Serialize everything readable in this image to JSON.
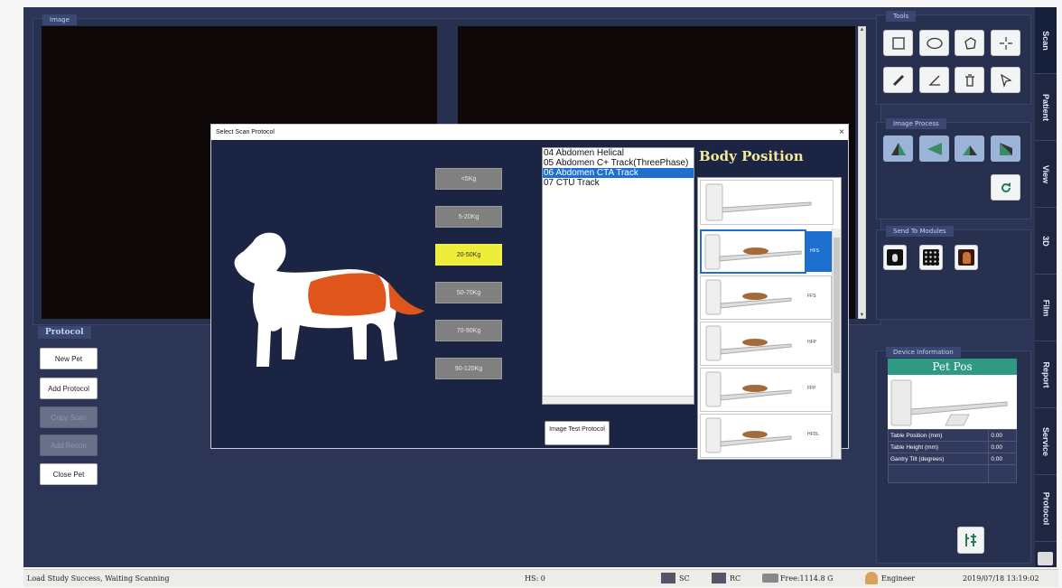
{
  "panels": {
    "image": "Image",
    "protocol": "Protocol",
    "tools": "Tools",
    "image_process": "Image Process",
    "send_to_modules": "Send To Modules",
    "device_info": "Device Information"
  },
  "protocol_buttons": [
    "New Pet",
    "Add Protocol",
    "Copy Scan",
    "Add Recon",
    "Close Pet"
  ],
  "tabs": [
    "Scan",
    "Patient",
    "View",
    "3D",
    "Film",
    "Report",
    "Service",
    "Protocol"
  ],
  "dialog": {
    "title": "Select Scan Protocol",
    "close": "×",
    "weights": [
      "<5Kg",
      "5-20Kg",
      "20-50Kg",
      "50-70Kg",
      "70-90Kg",
      "90-120Kg"
    ],
    "selected_weight": "20-50Kg",
    "protocols": [
      "04 Abdomen Helical",
      "05 Abdomen C+ Track(ThreePhase)",
      "06 Abdomen CTA Track",
      "07 CTU Track"
    ],
    "selected_protocol": "06 Abdomen CTA Track",
    "body_position_title": "Body Position",
    "positions": [
      "",
      "HFS",
      "FFS",
      "HFP",
      "FFP",
      "HFDL"
    ],
    "selected_position": "HFS",
    "image_test_button": "Image Test Protocol",
    "accent_color": "#1f6fcf",
    "highlight_color": "#e0551b"
  },
  "device": {
    "title": "Pet Pos",
    "rows": [
      {
        "label": "Table Position (mm)",
        "value": "0.00"
      },
      {
        "label": "Table Height (mm)",
        "value": "0.00"
      },
      {
        "label": "Gantry Tilt (degrees)",
        "value": "0.00"
      }
    ]
  },
  "status": {
    "message": "Load Study Success, Waiting Scanning",
    "hs": "HS: 0",
    "sc": "SC",
    "rc": "RC",
    "free": "Free:1114.8 G",
    "user": "Engineer",
    "datetime": "2019/07/18 13:19:02"
  }
}
